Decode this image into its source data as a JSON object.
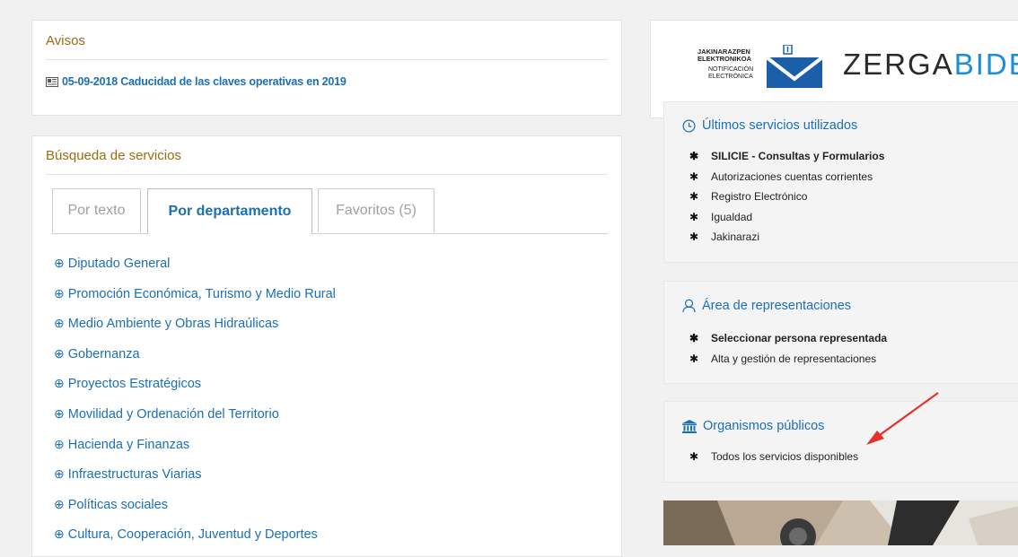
{
  "avisos": {
    "title": "Avisos",
    "item": "05-09-2018 Caducidad de las claves operativas en 2019"
  },
  "busqueda": {
    "title": "Búsqueda de servicios",
    "tabs": [
      "Por texto",
      "Por departamento",
      "Favoritos (5)"
    ],
    "active_tab": "Por departamento",
    "departments": [
      "Diputado General",
      "Promoción Económica, Turismo y Medio Rural",
      "Medio Ambiente y Obras Hidraúlicas",
      "Gobernanza",
      "Proyectos Estratégicos",
      "Movilidad y Ordenación del Territorio",
      "Hacienda y Finanzas",
      "Infraestructuras Viarias",
      "Políticas sociales",
      "Cultura, Cooperación, Juventud y Deportes"
    ]
  },
  "brand": {
    "jak_line1": "JAKINARAZPEN",
    "jak_line2": "ELEKTRONIKOA",
    "not_line1": "NOTIFICACIÓN",
    "not_line2": "ELECTRÓNICA",
    "zerga_part1": "ZERGA",
    "zerga_part2": "BIDEA"
  },
  "ultimos": {
    "title": "Últimos servicios utilizados",
    "items": [
      "SILICIE - Consultas y Formularios",
      "Autorizaciones cuentas corrientes",
      "Registro Electrónico",
      "Igualdad",
      "Jakinarazi"
    ]
  },
  "representaciones": {
    "title": "Área de representaciones",
    "items": [
      "Seleccionar persona representada",
      "Alta y gestión de representaciones"
    ]
  },
  "organismos": {
    "title": "Organismos públicos",
    "items": [
      "Todos los servicios disponibles"
    ]
  },
  "colors": {
    "link_blue": "#1a6fb5",
    "title_gold": "#9a6b14",
    "annotation_red": "#e8302a"
  }
}
